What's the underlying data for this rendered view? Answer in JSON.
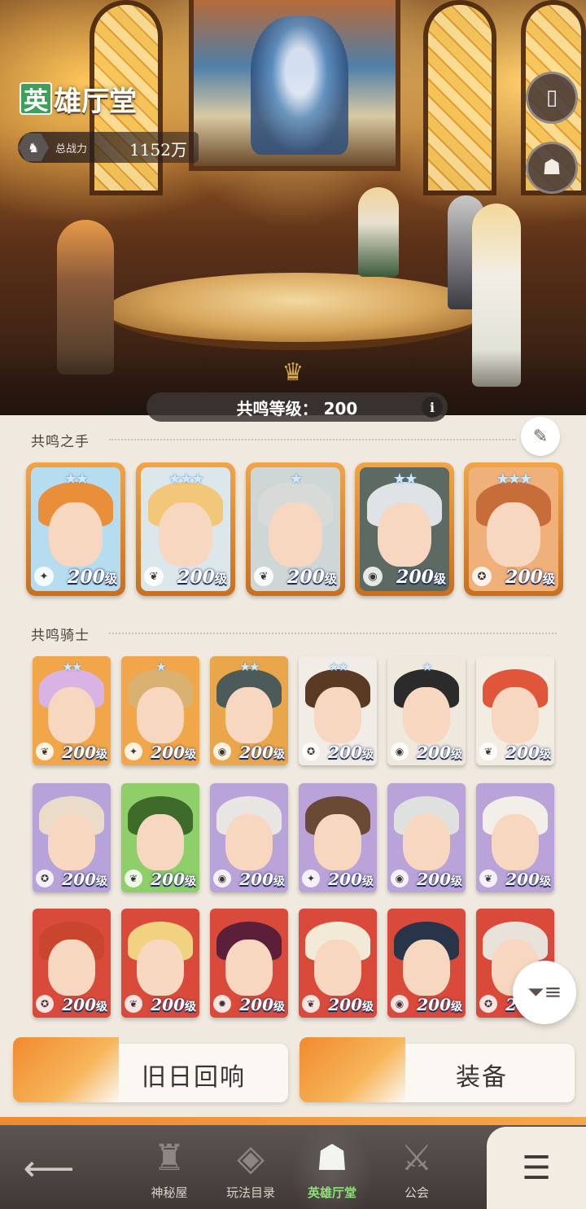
{
  "header": {
    "title_first": "英",
    "title_rest": "雄厅堂",
    "power_label": "总战力",
    "power_value": "1152万",
    "book_icon": "book-icon",
    "helmet_icon": "helmet-icon"
  },
  "resonance": {
    "level_text": "共鸣等级：  200",
    "info_label": "i"
  },
  "hands": {
    "title": "共鸣之手",
    "cards": [
      {
        "level": "200",
        "unit": "级",
        "stars": "★★",
        "hair": "#e98f3a",
        "bg": "#b6dcef",
        "cls": "✦"
      },
      {
        "level": "200",
        "unit": "级",
        "stars": "★★★",
        "hair": "#f3c77a",
        "bg": "#dbe7ea",
        "cls": "❦"
      },
      {
        "level": "200",
        "unit": "级",
        "stars": "★",
        "hair": "#d8dad7",
        "bg": "#cfd7d6",
        "cls": "❦"
      },
      {
        "level": "200",
        "unit": "级",
        "stars": "★★",
        "hair": "#dfe3e6",
        "bg": "#5d6a63",
        "cls": "◉"
      },
      {
        "level": "200",
        "unit": "级",
        "stars": "★★★",
        "hair": "#c76d3a",
        "bg": "#f0b07a",
        "cls": "✪"
      }
    ]
  },
  "knights": {
    "title": "共鸣骑士",
    "cards": [
      {
        "level": "200",
        "unit": "级",
        "stars": "★★",
        "hair": "#d8b3e3",
        "bg": "#f2a64a",
        "cls": "❦"
      },
      {
        "level": "200",
        "unit": "级",
        "stars": "★",
        "hair": "#d9b271",
        "bg": "#f2a64a",
        "cls": "✦"
      },
      {
        "level": "200",
        "unit": "级",
        "stars": "★★",
        "hair": "#4c5a5a",
        "bg": "#e9a64a",
        "cls": "◉"
      },
      {
        "level": "200",
        "unit": "级",
        "stars": "★★",
        "hair": "#5a3a22",
        "bg": "#f1ece6",
        "cls": "✪"
      },
      {
        "level": "200",
        "unit": "级",
        "stars": "★",
        "hair": "#2b2b2b",
        "bg": "#efe8dd",
        "cls": "◉"
      },
      {
        "level": "200",
        "unit": "级",
        "stars": "",
        "hair": "#e0563a",
        "bg": "#f3ece3",
        "cls": "❦"
      },
      {
        "level": "200",
        "unit": "级",
        "stars": "",
        "hair": "#eadcc8",
        "bg": "#b7a3d9",
        "cls": "✪"
      },
      {
        "level": "200",
        "unit": "级",
        "stars": "",
        "hair": "#3f6b2a",
        "bg": "#8ecf6a",
        "cls": "❦"
      },
      {
        "level": "200",
        "unit": "级",
        "stars": "",
        "hair": "#e7e6e2",
        "bg": "#b9a3d8",
        "cls": "◉"
      },
      {
        "level": "200",
        "unit": "级",
        "stars": "",
        "hair": "#6a4a35",
        "bg": "#b9a3d8",
        "cls": "✦"
      },
      {
        "level": "200",
        "unit": "级",
        "stars": "",
        "hair": "#dfe1df",
        "bg": "#b9a3d8",
        "cls": "◉"
      },
      {
        "level": "200",
        "unit": "级",
        "stars": "",
        "hair": "#f2efe9",
        "bg": "#b9a3d8",
        "cls": "❦"
      },
      {
        "level": "200",
        "unit": "级",
        "stars": "",
        "hair": "#c8452e",
        "bg": "#d94a3a",
        "cls": "✪"
      },
      {
        "level": "200",
        "unit": "级",
        "stars": "",
        "hair": "#f0d281",
        "bg": "#d94a3a",
        "cls": "❦"
      },
      {
        "level": "200",
        "unit": "级",
        "stars": "",
        "hair": "#5c1f3a",
        "bg": "#d94a3a",
        "cls": "✹"
      },
      {
        "level": "200",
        "unit": "级",
        "stars": "",
        "hair": "#f2ead7",
        "bg": "#d94a3a",
        "cls": "❦"
      },
      {
        "level": "200",
        "unit": "级",
        "stars": "",
        "hair": "#283548",
        "bg": "#d94a3a",
        "cls": "◉"
      },
      {
        "level": "200",
        "unit": "级",
        "stars": "",
        "hair": "#e9e2da",
        "bg": "#d94a3a",
        "cls": "✪"
      }
    ]
  },
  "actions": {
    "echo_label": "旧日回响",
    "equip_label": "装备"
  },
  "nav": {
    "back_icon": "back-arrow-icon",
    "items": [
      {
        "label": "神秘屋",
        "icon": "♜"
      },
      {
        "label": "玩法目录",
        "icon": "◈"
      },
      {
        "label": "英雄厅堂",
        "icon": "☗"
      },
      {
        "label": "公会",
        "icon": "⚔"
      }
    ],
    "menu_icon": "menu-list-icon"
  },
  "colors": {
    "active_nav": "#8fe07a",
    "accent_orange": "#f08a2e",
    "title_green": "#3fa05a"
  }
}
